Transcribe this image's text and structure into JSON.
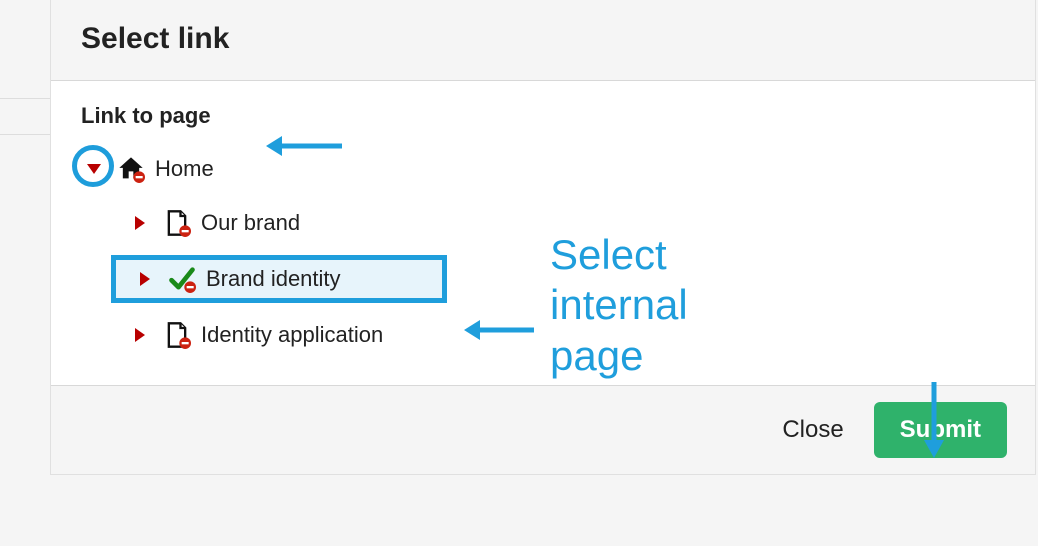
{
  "dialog": {
    "title": "Select link",
    "section_label": "Link to page",
    "footer": {
      "close_label": "Close",
      "submit_label": "Submit"
    }
  },
  "tree": {
    "home": {
      "label": "Home"
    },
    "items": [
      {
        "label": "Our brand"
      },
      {
        "label": "Brand identity"
      },
      {
        "label": "Identity application"
      }
    ]
  },
  "annotations": {
    "select_internal_line1": "Select",
    "select_internal_line2": "internal",
    "select_internal_line3": "page"
  },
  "colors": {
    "accent_annotation": "#1f9edc",
    "submit": "#2fb26b",
    "expand_triangle": "#b80000"
  }
}
